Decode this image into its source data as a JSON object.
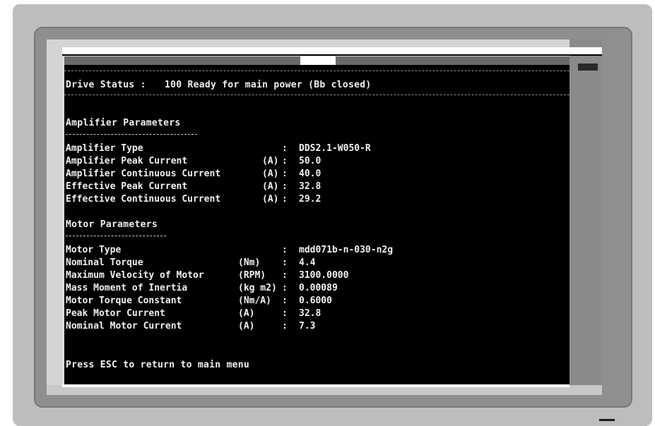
{
  "status": {
    "label": "Drive Status :",
    "value": "100 Ready for main power (Bb closed)"
  },
  "amplifier": {
    "title": "Amplifier Parameters",
    "rows": [
      {
        "label": "Amplifier Type",
        "unit": "",
        "sep": ":",
        "value": "DDS2.1-W050-R"
      },
      {
        "label": "Amplifier Peak Current",
        "unit": "(A)",
        "sep": ":",
        "value": "50.0"
      },
      {
        "label": "Amplifier Continuous Current",
        "unit": "(A)",
        "sep": ":",
        "value": "40.0"
      },
      {
        "label": "Effective Peak Current",
        "unit": "(A)",
        "sep": ":",
        "value": "32.8"
      },
      {
        "label": "Effective Continuous Current",
        "unit": "(A)",
        "sep": ":",
        "value": "29.2"
      }
    ]
  },
  "motor": {
    "title": "Motor Parameters",
    "rows": [
      {
        "label": "Motor Type",
        "unit": "",
        "sep": ":",
        "value": "mdd071b-n-030-n2g"
      },
      {
        "label": "Nominal Torque",
        "unit": "(Nm)",
        "sep": ":",
        "value": "4.4"
      },
      {
        "label": "Maximum Velocity of Motor",
        "unit": "(RPM)",
        "sep": ":",
        "value": "3100.0000"
      },
      {
        "label": "Mass Moment of Inertia",
        "unit": "(kg m2)",
        "sep": ":",
        "value": "0.00089"
      },
      {
        "label": "Motor Torque Constant",
        "unit": "(Nm/A)",
        "sep": ":",
        "value": "0.6000"
      },
      {
        "label": "Peak Motor Current",
        "unit": "(A)",
        "sep": ":",
        "value": "32.8"
      },
      {
        "label": "Nominal Motor Current",
        "unit": "(A)",
        "sep": ":",
        "value": "7.3"
      }
    ]
  },
  "footer": {
    "hint": "Press ESC to return to main menu"
  },
  "colors": {
    "screen_bg": "#000000",
    "text": "#f2f2f2",
    "bezel": "#bdbdbd"
  }
}
